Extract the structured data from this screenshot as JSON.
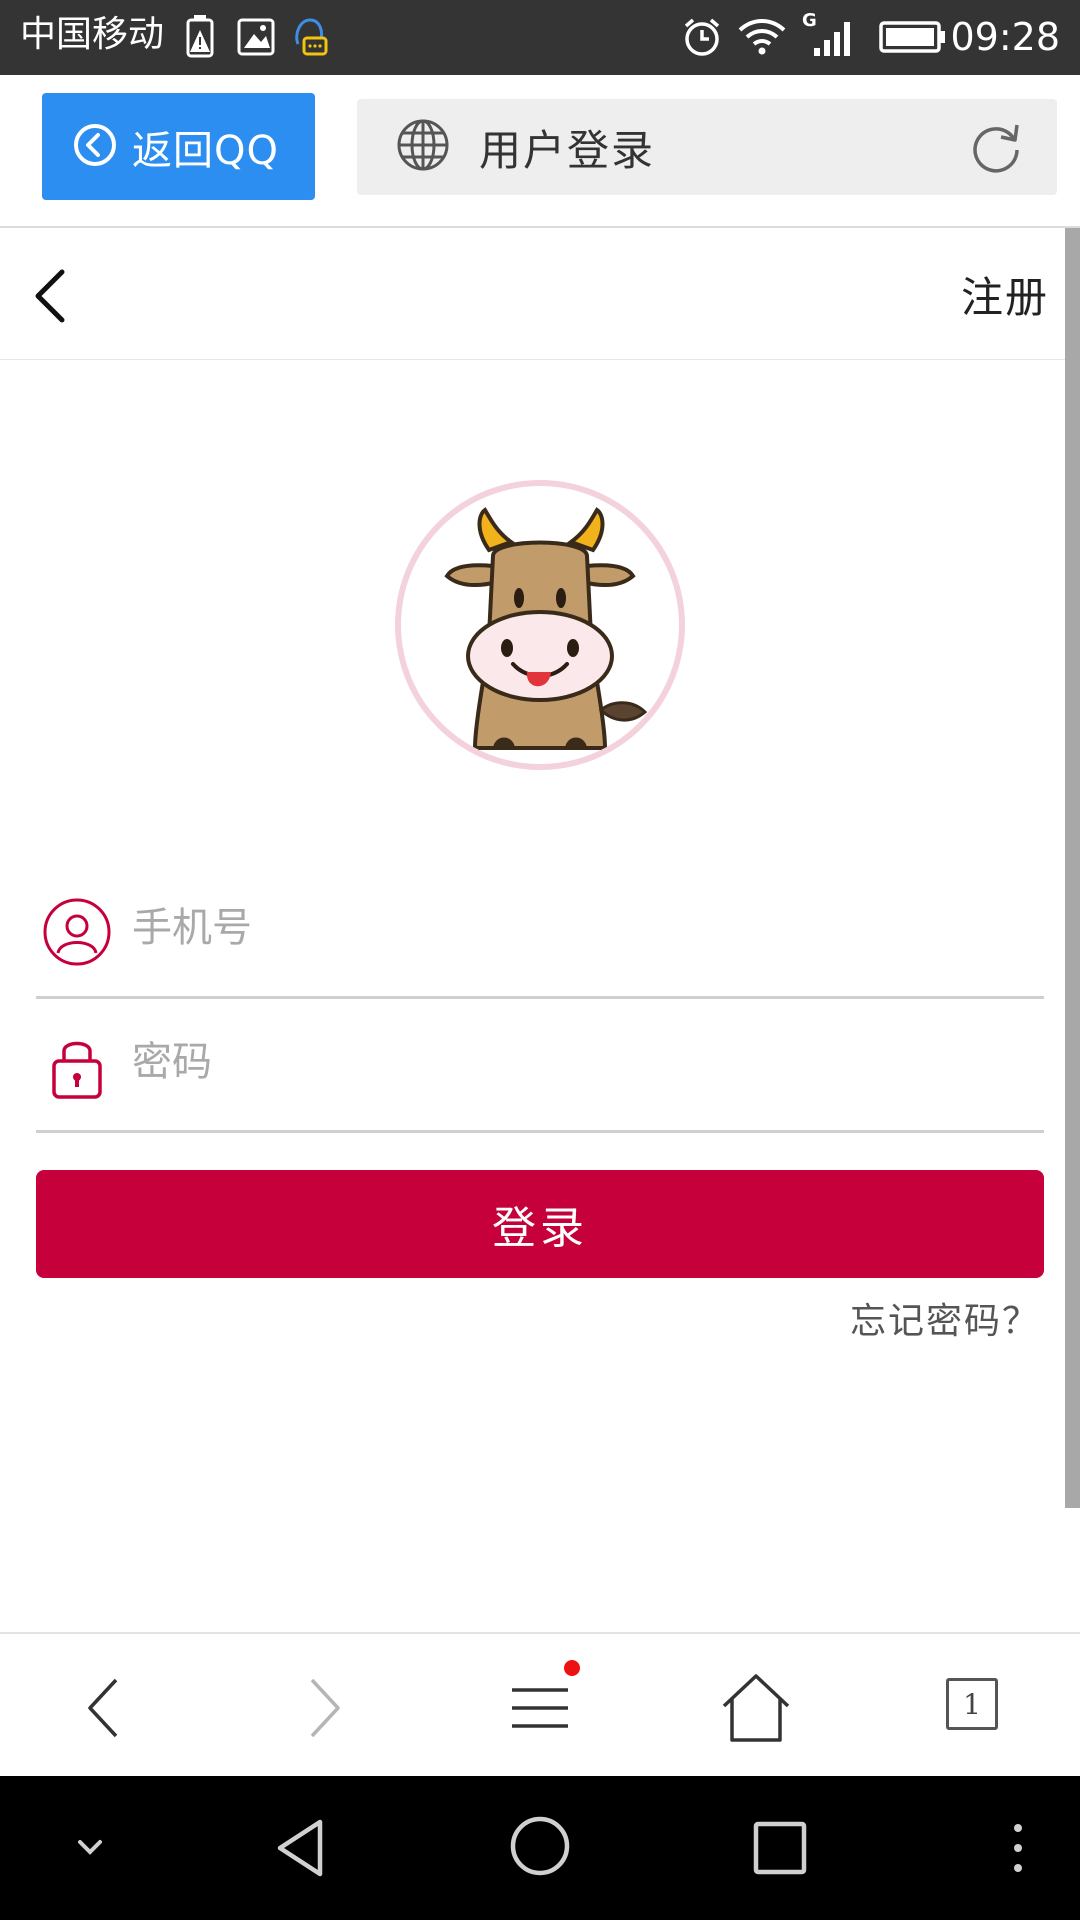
{
  "status_bar": {
    "carrier": "中国移动",
    "time": "09:28",
    "network_type": "G",
    "icons": [
      "battery-alert-icon",
      "image-icon",
      "qq-notification-icon",
      "alarm-icon",
      "wifi-icon",
      "signal-icon",
      "battery-icon"
    ]
  },
  "browser": {
    "back_qq_label": "返回QQ",
    "page_title": "用户登录",
    "tab_count": "1",
    "accent_color": "#2b8ef0"
  },
  "header": {
    "register_label": "注册"
  },
  "form": {
    "phone_placeholder": "手机号",
    "phone_value": "",
    "password_placeholder": "密码",
    "password_value": "",
    "login_label": "登录",
    "forgot_label": "忘记密码？",
    "primary_color": "#c6003a"
  }
}
